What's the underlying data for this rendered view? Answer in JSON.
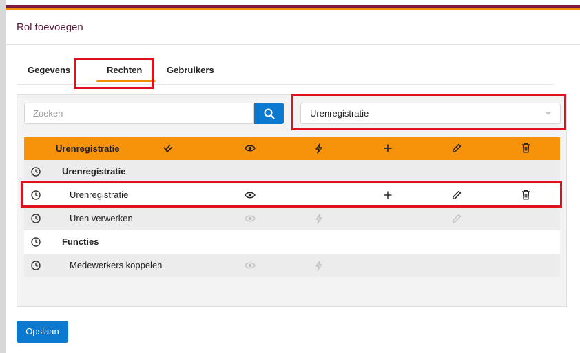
{
  "dialog": {
    "title": "Rol toevoegen"
  },
  "tabs": [
    {
      "label": "Gegevens"
    },
    {
      "label": "Rechten",
      "active": true
    },
    {
      "label": "Gebruikers"
    }
  ],
  "search": {
    "placeholder": "Zoeken",
    "value": "",
    "button_icon": "search-icon"
  },
  "module_select": {
    "selected": "Urenregistratie"
  },
  "grid": {
    "header": {
      "label": "Urenregistratie",
      "column_icons": [
        "check-all-icon",
        "eye-icon",
        "bolt-icon",
        "plus-icon",
        "pencil-icon",
        "trash-icon"
      ]
    },
    "rows": [
      {
        "type": "group",
        "label": "Urenregistratie",
        "icons": []
      },
      {
        "type": "item",
        "label": "Urenregistratie",
        "icons": [
          "eye-icon",
          "plus-icon",
          "pencil-icon",
          "trash-icon"
        ],
        "highlighted": true
      },
      {
        "type": "item",
        "label": "Uren verwerken",
        "icons": [
          "eye-icon",
          "bolt-icon",
          "pencil-icon"
        ],
        "disabled": true
      },
      {
        "type": "group",
        "label": "Functies",
        "icons": []
      },
      {
        "type": "item",
        "label": "Medewerkers koppelen",
        "icons": [
          "eye-icon",
          "bolt-icon"
        ],
        "disabled": true
      }
    ],
    "row_icon": "clock-icon"
  },
  "footer": {
    "save_label": "Opslaan"
  },
  "colors": {
    "accent_orange": "#f7930a",
    "brand_dark": "#7a1b3f",
    "primary_blue": "#0b79d0",
    "highlight_red": "#e0101e"
  }
}
